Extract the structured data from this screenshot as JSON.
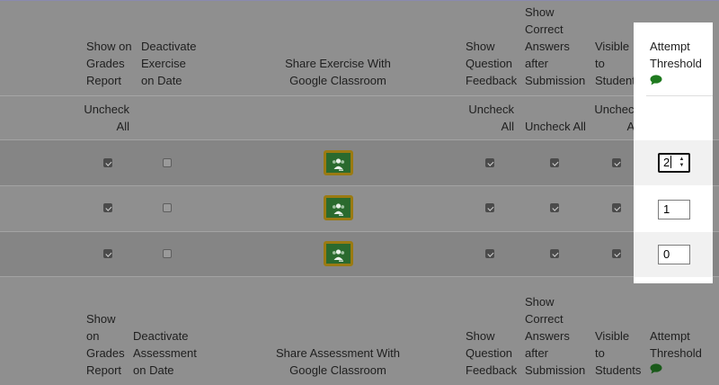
{
  "top_headers": {
    "show_on_grades_report": [
      "Show on",
      "Grades",
      "Report"
    ],
    "deactivate_exercise": [
      "Deactivate",
      "Exercise",
      "on Date"
    ],
    "share_exercise": [
      "Share Exercise With",
      "Google Classroom"
    ],
    "show_question_feedback": [
      "Show",
      "Question",
      "Feedback"
    ],
    "show_correct_answers": [
      "Show",
      "Correct",
      "Answers",
      "after",
      "Submission"
    ],
    "visible_to_students": [
      "Visible",
      "to",
      "Students"
    ],
    "attempt_threshold": [
      "Attempt",
      "Threshold"
    ]
  },
  "uncheck_all": {
    "grades": [
      "Uncheck",
      "All"
    ],
    "feedback": [
      "Uncheck",
      "All"
    ],
    "correct": "Uncheck All",
    "visible": [
      "Uncheck",
      "All"
    ]
  },
  "exercise_rows": [
    {
      "show_on_grades": true,
      "deactivate": false,
      "share_icon": "google-classroom-icon",
      "feedback": true,
      "correct": true,
      "visible": true,
      "attempt_threshold": "2"
    },
    {
      "show_on_grades": true,
      "deactivate": false,
      "share_icon": "google-classroom-icon",
      "feedback": true,
      "correct": true,
      "visible": true,
      "attempt_threshold": "1"
    },
    {
      "show_on_grades": true,
      "deactivate": false,
      "share_icon": "google-classroom-icon",
      "feedback": true,
      "correct": true,
      "visible": true,
      "attempt_threshold": "0"
    }
  ],
  "bottom_headers": {
    "show_on_grades_report": [
      "Show",
      "on",
      "Grades",
      "Report"
    ],
    "deactivate_assessment": [
      "Deactivate",
      "Assessment",
      "on Date"
    ],
    "share_assessment": [
      "Share Assessment With",
      "Google Classroom"
    ],
    "show_question_feedback": [
      "Show",
      "Question",
      "Feedback"
    ],
    "show_correct_answers": [
      "Show",
      "Correct",
      "Answers",
      "after",
      "Submission"
    ],
    "visible_to_students": [
      "Visible",
      "to",
      "Students"
    ],
    "attempt_threshold": [
      "Attempt",
      "Threshold"
    ]
  },
  "colors": {
    "overlay": "#8f8f8f",
    "highlight": "#ffffff",
    "classroom_green": "#2a6a2e",
    "classroom_border": "#9a7a12",
    "comment_green": "#1f7a1f"
  }
}
